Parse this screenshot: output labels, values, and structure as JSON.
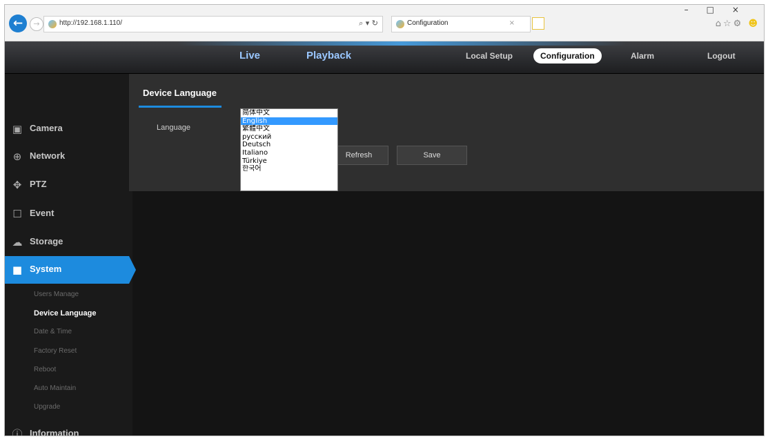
{
  "browser": {
    "url": "http://192.168.1.110/",
    "address_tools": "⌕ ▾ ↻",
    "tab_title": "Configuration",
    "tab_close": "×",
    "back_glyph": "←",
    "forward_glyph": "→",
    "window_buttons": "–□×",
    "toolbar_icons": "⌂☆⚙"
  },
  "topnav": {
    "live": "Live",
    "playback": "Playback",
    "local_setup": "Local Setup",
    "configuration": "Configuration",
    "alarm": "Alarm",
    "logout": "Logout"
  },
  "sidebar": {
    "items": [
      {
        "label": "Camera",
        "icon": "camera-icon",
        "glyph": "▣"
      },
      {
        "label": "Network",
        "icon": "network-icon",
        "glyph": "⊕"
      },
      {
        "label": "PTZ",
        "icon": "ptz-icon",
        "glyph": "✥"
      },
      {
        "label": "Event",
        "icon": "event-icon",
        "glyph": "☐"
      },
      {
        "label": "Storage",
        "icon": "storage-icon",
        "glyph": "☁"
      },
      {
        "label": "System",
        "icon": "system-icon",
        "glyph": "■"
      },
      {
        "label": "Information",
        "icon": "info-icon",
        "glyph": "ⓘ"
      }
    ],
    "system_sub": [
      "Users Manage",
      "Device Language",
      "Date & Time",
      "Factory Reset",
      "Reboot",
      "Auto Maintain",
      "Upgrade"
    ]
  },
  "content": {
    "title": "Device Language",
    "language_label": "Language",
    "refresh_button": "Refresh",
    "save_button": "Save",
    "language_options": [
      "简体中文",
      "English",
      "繁體中文",
      "русский",
      "Deutsch",
      "Italiano",
      "Türkiye",
      "한국어"
    ],
    "selected_language": "English"
  },
  "colors": {
    "accent": "#1d8bde",
    "background": "#141414",
    "panel": "#2f2f2f"
  }
}
